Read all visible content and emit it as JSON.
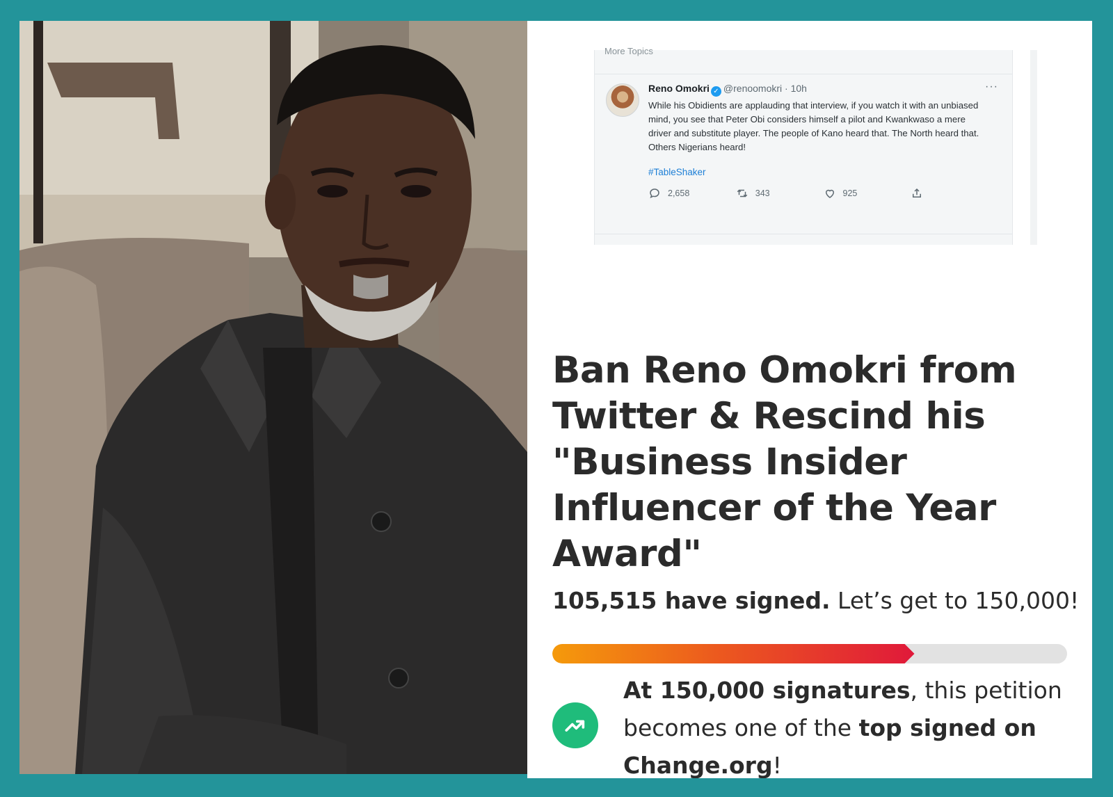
{
  "tweet": {
    "header_cutoff": "More Topics",
    "author_name": "Reno Omokri",
    "handle": "@renoomokri",
    "time": "10h",
    "more_glyph": "···",
    "text": "While his Obidients are applauding that interview, if you watch it with an unbiased mind, you see that Peter Obi considers himself a pilot and Kwankwaso a mere driver and substitute player. The people of Kano heard that. The North heard that. Others Nigerians heard!",
    "hashtag": "#TableShaker",
    "replies": "2,658",
    "retweets": "343",
    "likes": "925",
    "icons": {
      "verified": "verified-badge-icon",
      "reply": "reply-icon",
      "retweet": "retweet-icon",
      "like": "heart-icon",
      "share": "share-icon"
    }
  },
  "petition": {
    "title": "Ban Reno Omokri from Twitter & Rescind his \"Business Insider Influencer of the Year Award\"",
    "signed_count_text": "105,515 have signed.",
    "goal_text": " Let’s get to 150,000!",
    "signed": 105515,
    "goal": 150000,
    "milestone_bold_1": "At 150,000 signatures",
    "milestone_plain_1": ", this petition becomes one of the ",
    "milestone_bold_2": "top signed on Change.org",
    "milestone_plain_2": "!",
    "icon": "trending-up-icon"
  },
  "colors": {
    "frame": "#23949a",
    "progress_start": "#f59a0b",
    "progress_end": "#e0193a",
    "trend_green": "#1fbc7b",
    "twitter_blue": "#1d9bf0"
  }
}
